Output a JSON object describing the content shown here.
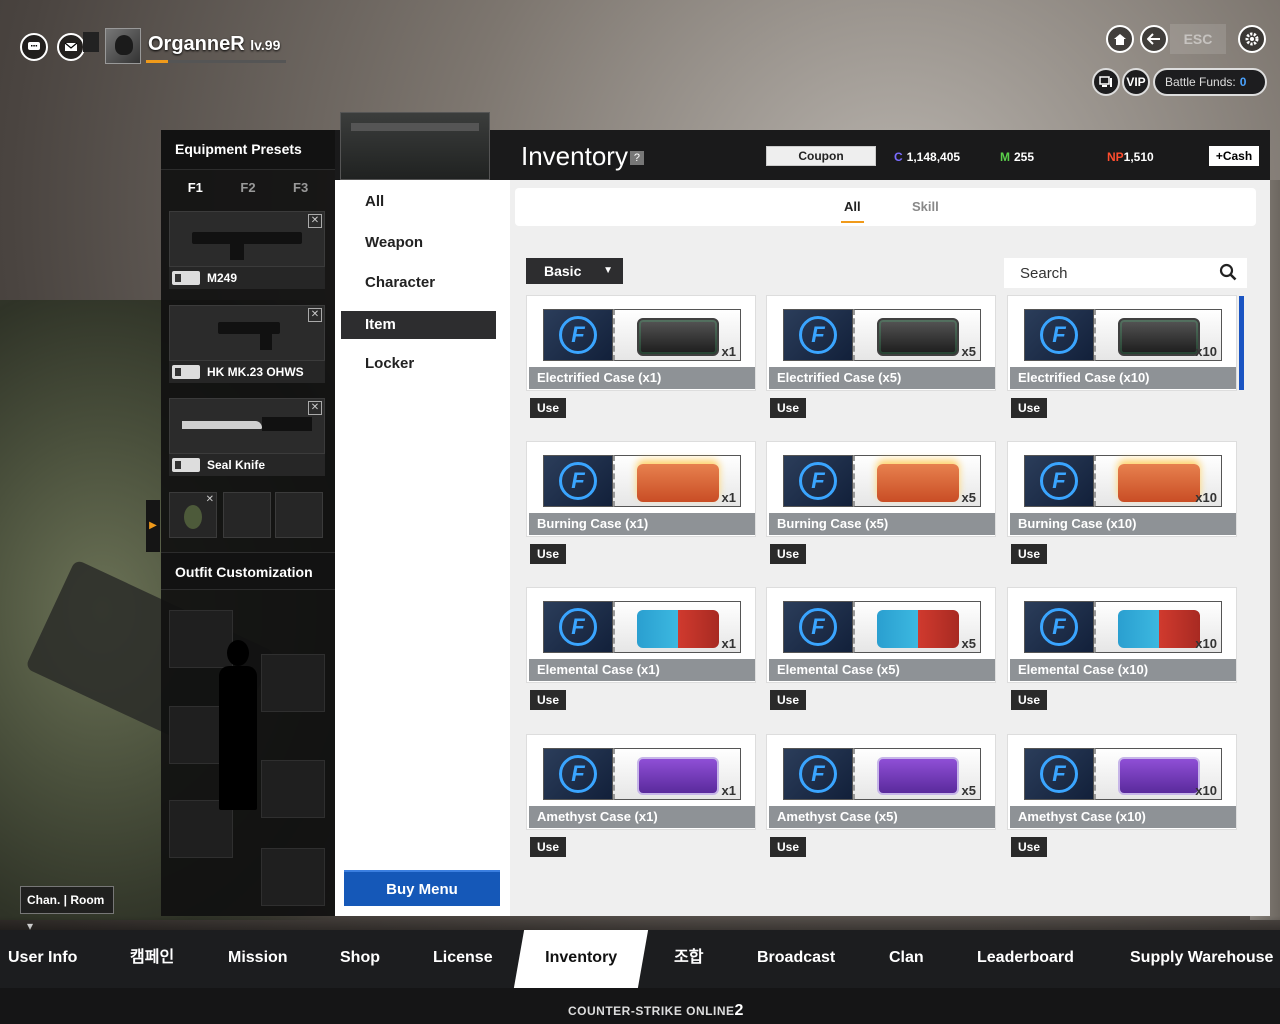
{
  "player": {
    "name": "OrganneR",
    "level": "lv.99",
    "exp_fraction": 0.16
  },
  "topbar": {
    "esc_label": "ESC",
    "vip_label": "VIP",
    "battle_funds_label": "Battle Funds:",
    "battle_funds_value": "0"
  },
  "presets": {
    "title": "Equipment Presets",
    "tabs": [
      "F1",
      "F2",
      "F3"
    ],
    "active_tab": "F1",
    "slots": [
      {
        "name": "M249",
        "icon": "machine-gun"
      },
      {
        "name": "HK MK.23 OHWS",
        "icon": "pistol"
      },
      {
        "name": "Seal Knife",
        "icon": "knife"
      }
    ],
    "outfit_title": "Outfit Customization"
  },
  "chanroom": {
    "label": "Chan. | Room ▾"
  },
  "inventory": {
    "title": "Inventory",
    "coupon_label": "Coupon",
    "currencies": [
      {
        "symbol": "C",
        "value": "1,148,405",
        "color": "#7a6cff"
      },
      {
        "symbol": "M",
        "value": "255",
        "color": "#5ad04a"
      },
      {
        "symbol": "NP",
        "value": "1,510",
        "color": "#ff4d2e"
      }
    ],
    "cash_label": "+Cash"
  },
  "categories": {
    "items": [
      "All",
      "Weapon",
      "Character",
      "Item",
      "Locker"
    ],
    "active": "Item",
    "buy_menu_label": "Buy Menu"
  },
  "subtabs": {
    "items": [
      "All",
      "Skill"
    ],
    "active": "All"
  },
  "filter": {
    "selected": "Basic"
  },
  "search": {
    "placeholder": "Search"
  },
  "cards": [
    {
      "name": "Electrified Case (x1)",
      "qty": "x1",
      "type": "electrified",
      "use": "Use"
    },
    {
      "name": "Electrified Case (x5)",
      "qty": "x5",
      "type": "electrified",
      "use": "Use"
    },
    {
      "name": "Electrified Case (x10)",
      "qty": "x10",
      "type": "electrified",
      "use": "Use"
    },
    {
      "name": "Burning Case (x1)",
      "qty": "x1",
      "type": "burning",
      "use": "Use"
    },
    {
      "name": "Burning Case (x5)",
      "qty": "x5",
      "type": "burning",
      "use": "Use"
    },
    {
      "name": "Burning Case (x10)",
      "qty": "x10",
      "type": "burning",
      "use": "Use"
    },
    {
      "name": "Elemental Case (x1)",
      "qty": "x1",
      "type": "elemental",
      "use": "Use"
    },
    {
      "name": "Elemental Case (x5)",
      "qty": "x5",
      "type": "elemental",
      "use": "Use"
    },
    {
      "name": "Elemental Case (x10)",
      "qty": "x10",
      "type": "elemental",
      "use": "Use"
    },
    {
      "name": "Amethyst Case (x1)",
      "qty": "x1",
      "type": "amethyst",
      "use": "Use"
    },
    {
      "name": "Amethyst Case (x5)",
      "qty": "x5",
      "type": "amethyst",
      "use": "Use"
    },
    {
      "name": "Amethyst Case (x10)",
      "qty": "x10",
      "type": "amethyst",
      "use": "Use"
    }
  ],
  "bottom_nav": {
    "items": [
      "User Info",
      "캠페인",
      "Mission",
      "Shop",
      "License",
      "Inventory",
      "조합",
      "Broadcast",
      "Clan",
      "Leaderboard",
      "Supply Warehouse"
    ],
    "active": "Inventory"
  },
  "footer": {
    "logo_text": "COUNTER-STRIKE ONLINE",
    "logo_number": "2"
  },
  "colors": {
    "accent": "#f09a1a",
    "buy_menu": "#1558b8",
    "battle_funds_value": "#4aa3ff"
  }
}
